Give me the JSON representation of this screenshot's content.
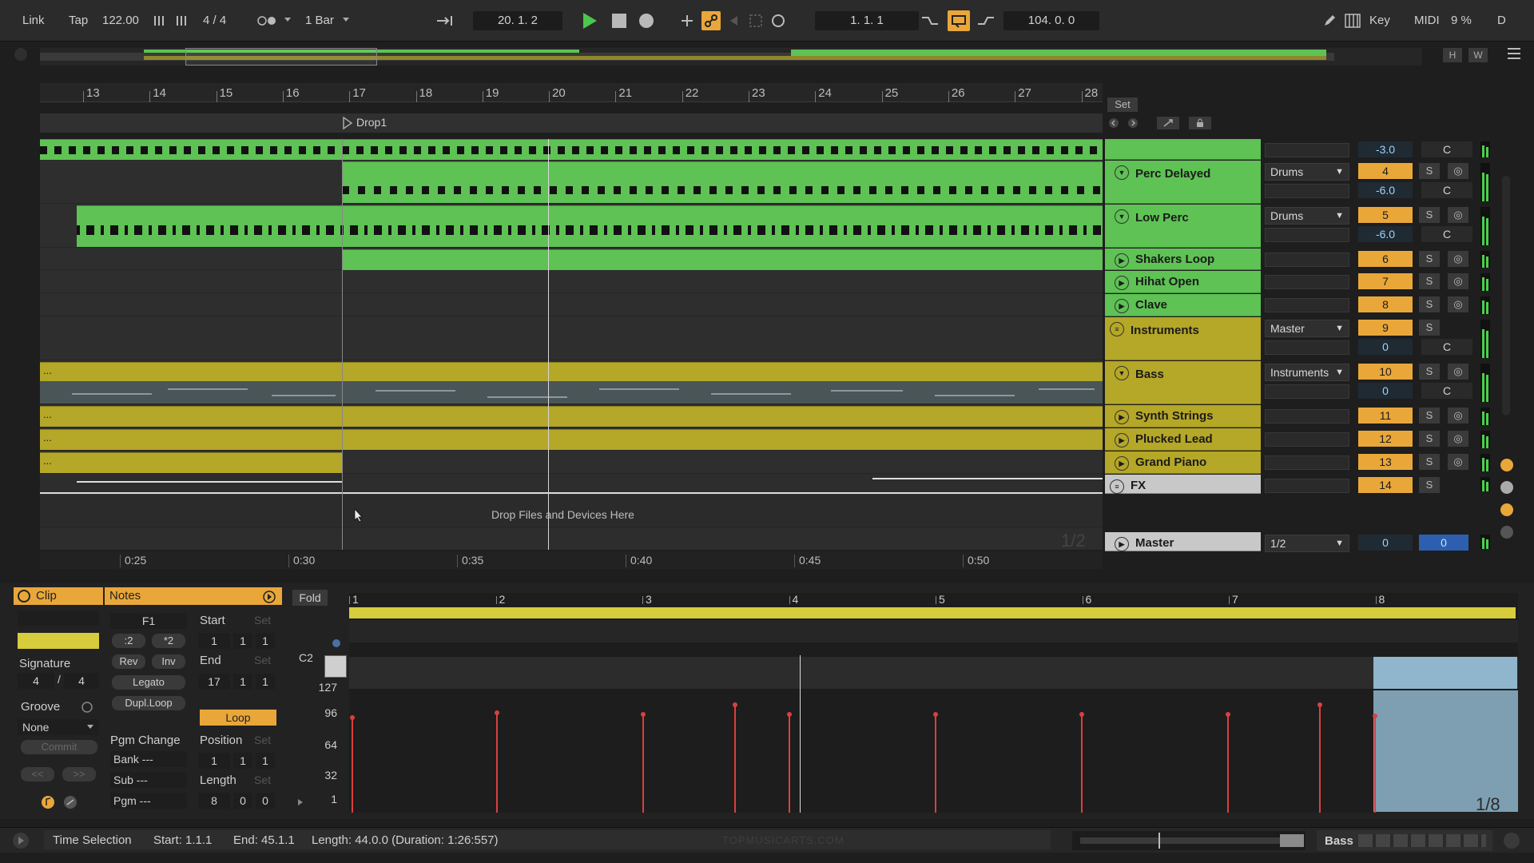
{
  "transport": {
    "link": "Link",
    "tap": "Tap",
    "tempo": "122.00",
    "time_signature": "4 / 4",
    "quantize": "1 Bar",
    "arrangement_position": "20.  1.  2",
    "loop_start": "1.  1.  1",
    "loop_length": "104.  0.  0",
    "key": "Key",
    "midi": "MIDI",
    "cpu": "9 %",
    "d": "D"
  },
  "overview": {
    "h": "H",
    "w": "W"
  },
  "ruler": {
    "bars": [
      "13",
      "14",
      "15",
      "16",
      "17",
      "18",
      "19",
      "20",
      "21",
      "22",
      "23",
      "24",
      "25",
      "26",
      "27",
      "28"
    ]
  },
  "locator": {
    "name": "Drop1",
    "set_label": "Set"
  },
  "arrangement": {
    "drop_hint": "Drop Files and Devices Here",
    "zoom": "1/2",
    "dots": "..."
  },
  "time_ruler": [
    "0:25",
    "0:30",
    "0:35",
    "0:40",
    "0:45",
    "0:50"
  ],
  "tracks": [
    {
      "name": "",
      "color": "#5ec254",
      "input": "",
      "num": "",
      "volume": "-3.0",
      "pan": "C"
    },
    {
      "name": "Perc Delayed",
      "color": "#5ec254",
      "input": "Drums",
      "num": "4",
      "volume": "-6.0",
      "pan": "C",
      "solo": "S"
    },
    {
      "name": "Low Perc",
      "color": "#5ec254",
      "input": "Drums",
      "num": "5",
      "volume": "-6.0",
      "pan": "C",
      "solo": "S"
    },
    {
      "name": "Shakers Loop",
      "color": "#5ec254",
      "num": "6",
      "solo": "S"
    },
    {
      "name": "Hihat Open",
      "color": "#5ec254",
      "num": "7",
      "solo": "S"
    },
    {
      "name": "Clave",
      "color": "#5ec254",
      "num": "8",
      "solo": "S"
    },
    {
      "name": "Instruments",
      "color": "#b5a727",
      "input": "Master",
      "num": "9",
      "volume": "0",
      "pan": "C",
      "solo": "S"
    },
    {
      "name": "Bass",
      "color": "#b5a727",
      "input": "Instruments",
      "num": "10",
      "volume": "0",
      "pan": "C",
      "solo": "S"
    },
    {
      "name": "Synth Strings",
      "color": "#b5a727",
      "num": "11",
      "solo": "S"
    },
    {
      "name": "Plucked Lead",
      "color": "#b5a727",
      "num": "12",
      "solo": "S"
    },
    {
      "name": "Grand Piano",
      "color": "#b5a727",
      "num": "13",
      "solo": "S"
    },
    {
      "name": "FX",
      "color": "#c8c8c8",
      "num": "14",
      "solo": "S"
    },
    {
      "name": "Master",
      "color": "#c8c8c8",
      "input": "1/2",
      "volume": "0",
      "pan": "0"
    }
  ],
  "clip_panel": {
    "clip_title": "Clip",
    "notes_title": "Notes",
    "key": "F1",
    "div2": ":2",
    "mul2": "*2",
    "rev": "Rev",
    "inv": "Inv",
    "legato": "Legato",
    "dupl": "Dupl.Loop",
    "signature_label": "Signature",
    "sig_num": "4",
    "sig_den": "4",
    "groove_label": "Groove",
    "groove_value": "None",
    "commit": "Commit",
    "prev": "<<",
    "next": ">>",
    "start_label": "Start",
    "end_label": "End",
    "set": "Set",
    "start": [
      "1",
      "1",
      "1"
    ],
    "end": [
      "17",
      "1",
      "1"
    ],
    "loop": "Loop",
    "position_label": "Position",
    "position": [
      "1",
      "1",
      "1"
    ],
    "length_label": "Length",
    "length": [
      "8",
      "0",
      "0"
    ],
    "pgm_change": "Pgm Change",
    "bank": "Bank ---",
    "sub": "Sub ---",
    "pgm": "Pgm ---"
  },
  "note_editor": {
    "fold": "Fold",
    "bars": [
      "1",
      "2",
      "3",
      "4",
      "5",
      "6",
      "7",
      "8"
    ],
    "pitch_label": "C2",
    "velocity_scale": [
      "127",
      "96",
      "64",
      "32",
      "1"
    ],
    "grid": "1/8"
  },
  "status_bar": {
    "mode": "Time Selection",
    "start": "Start: 1.1.1",
    "end": "End: 45.1.1",
    "length": "Length: 44.0.0 (Duration: 1:26:557)",
    "watermark": "TOPMUSICARTS.COM",
    "track": "Bass"
  }
}
